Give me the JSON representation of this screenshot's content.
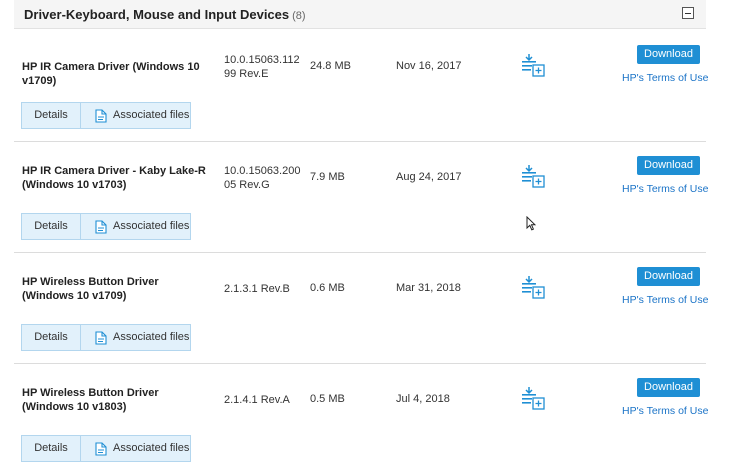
{
  "section": {
    "title": "Driver-Keyboard, Mouse and Input Devices",
    "count": "(8)"
  },
  "drivers": [
    {
      "name": "HP IR Camera Driver (Windows 10 v1709)",
      "version": "10.0.15063.11299 Rev.E",
      "size": "24.8 MB",
      "date": "Nov 16, 2017"
    },
    {
      "name": "HP IR Camera Driver - Kaby Lake-R (Windows 10 v1703)",
      "version": "10.0.15063.20005 Rev.G",
      "size": "7.9 MB",
      "date": "Aug 24, 2017"
    },
    {
      "name": "HP Wireless Button Driver (Windows 10 v1709)",
      "version": "2.1.3.1 Rev.B",
      "size": "0.6 MB",
      "date": "Mar 31, 2018"
    },
    {
      "name": "HP Wireless Button Driver (Windows 10 v1803)",
      "version": "2.1.4.1 Rev.A",
      "size": "0.5 MB",
      "date": "Jul 4, 2018"
    }
  ],
  "labels": {
    "download": "Download",
    "terms": "HP's Terms of Use",
    "details": "Details",
    "associated_files": "Associated files"
  },
  "colors": {
    "accent": "#1f8fd4",
    "link": "#1a73c7",
    "tab_bg": "#e2f1fb"
  },
  "icons": [
    "collapse-icon",
    "add-to-list-icon",
    "file-icon",
    "mouse-cursor-icon"
  ]
}
